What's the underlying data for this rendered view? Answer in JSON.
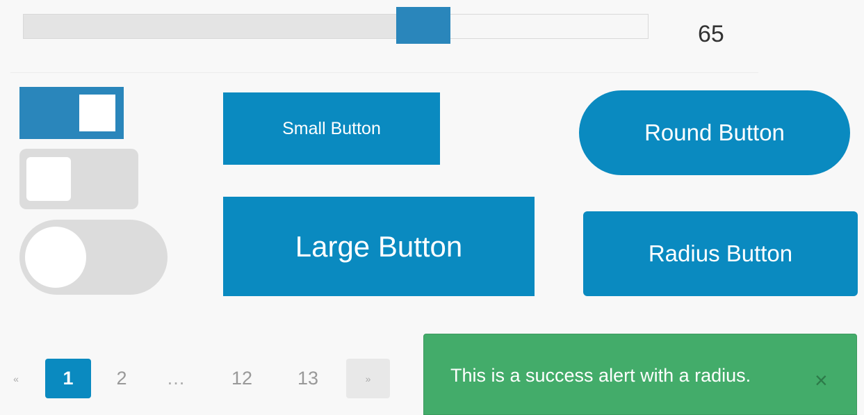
{
  "slider": {
    "value": "65",
    "fraction": 0.65
  },
  "switches": [
    {
      "style": "square",
      "state": "on"
    },
    {
      "style": "radius",
      "state": "off"
    },
    {
      "style": "round",
      "state": "off"
    }
  ],
  "buttons": {
    "small": "Small Button",
    "large": "Large Button",
    "round": "Round Button",
    "radius": "Radius Button"
  },
  "pagination": {
    "prev": "«",
    "pages": [
      "1",
      "2",
      "…",
      "12",
      "13"
    ],
    "current": "1",
    "next": "»"
  },
  "alert": {
    "text": "This is a success alert with a radius.",
    "close": "×"
  },
  "colors": {
    "primary": "#0a8ac0",
    "slider_handle": "#2a86bb",
    "success": "#43ac6a"
  }
}
